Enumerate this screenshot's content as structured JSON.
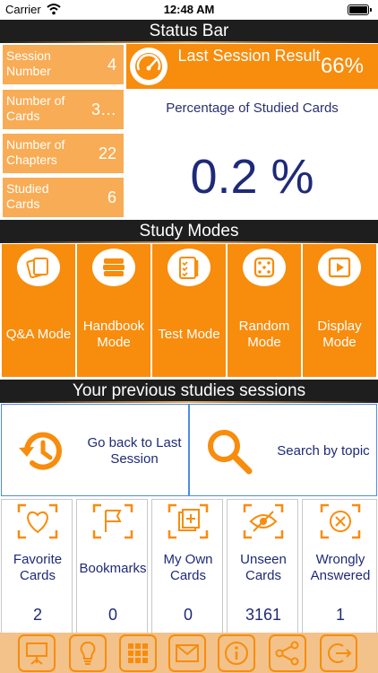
{
  "ios_status": {
    "carrier": "Carrier",
    "time": "12:48 AM"
  },
  "status_bar": {
    "title": "Status Bar",
    "stats": [
      {
        "label": "Session Number",
        "value": "4"
      },
      {
        "label": "Number of Cards",
        "value": "3…"
      },
      {
        "label": "Number of Chapters",
        "value": "22"
      },
      {
        "label": "Studied Cards",
        "value": "6"
      }
    ],
    "last_session": {
      "label": "Last Session Result",
      "value": "66%",
      "icon": "gauge-icon"
    },
    "studied_percentage": {
      "title": "Percentage of Studied Cards",
      "value": "0.2 %"
    }
  },
  "study_modes": {
    "title": "Study Modes",
    "modes": [
      {
        "label": "Q&A Mode",
        "icon": "cards-icon"
      },
      {
        "label": "Handbook Mode",
        "icon": "books-icon"
      },
      {
        "label": "Test Mode",
        "icon": "checklist-icon"
      },
      {
        "label": "Random Mode",
        "icon": "dice-icon"
      },
      {
        "label": "Display Mode",
        "icon": "play-icon"
      }
    ]
  },
  "previous_sessions": {
    "title": "Your previous studies sessions",
    "go_back_label": "Go back to Last Session",
    "search_label": "Search by topic"
  },
  "card_stats": [
    {
      "label": "Favorite Cards",
      "count": "2",
      "icon": "heart-icon"
    },
    {
      "label": "Bookmarks",
      "count": "0",
      "icon": "flag-icon"
    },
    {
      "label": "My Own Cards",
      "count": "0",
      "icon": "add-card-icon"
    },
    {
      "label": "Unseen Cards",
      "count": "3161",
      "icon": "eye-off-icon"
    },
    {
      "label": "Wrongly Answered",
      "count": "1",
      "icon": "x-circle-icon"
    }
  ],
  "colors": {
    "orange": "#f88c0c",
    "light_orange": "#f8ac55",
    "navy": "#1e2a78",
    "bar": "#f2c28a"
  }
}
